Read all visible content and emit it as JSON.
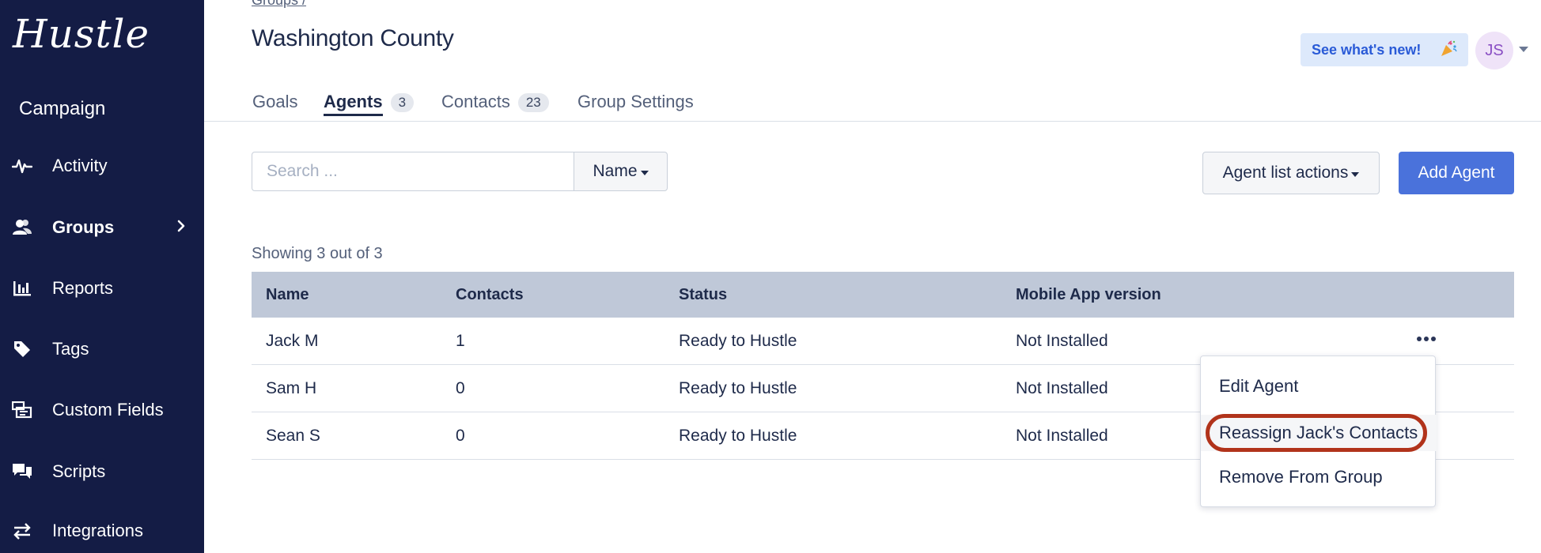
{
  "sidebar": {
    "logo": "Hustle",
    "section_title": "Campaign",
    "items": [
      {
        "label": "Activity",
        "icon": "pulse-icon"
      },
      {
        "label": "Groups",
        "icon": "users-icon",
        "active": true
      },
      {
        "label": "Reports",
        "icon": "bar-chart-icon"
      },
      {
        "label": "Tags",
        "icon": "tag-icon"
      },
      {
        "label": "Custom Fields",
        "icon": "form-fields-icon"
      },
      {
        "label": "Scripts",
        "icon": "chat-bubbles-icon"
      },
      {
        "label": "Integrations",
        "icon": "swap-arrows-icon"
      }
    ]
  },
  "header": {
    "breadcrumb": "Groups /",
    "title": "Washington County",
    "whats_new": "See what's new!",
    "whats_new_icon": "party-popper-icon",
    "avatar_initials": "JS"
  },
  "tabs": [
    {
      "label": "Goals"
    },
    {
      "label": "Agents",
      "count": "3",
      "active": true
    },
    {
      "label": "Contacts",
      "count": "23"
    },
    {
      "label": "Group Settings"
    }
  ],
  "toolbar": {
    "search_placeholder": "Search ...",
    "sort_label": "Name",
    "list_actions_label": "Agent list actions",
    "add_agent_label": "Add Agent"
  },
  "showing_text": "Showing 3 out of 3",
  "table": {
    "columns": [
      "Name",
      "Contacts",
      "Status",
      "Mobile App version"
    ],
    "rows": [
      {
        "name": "Jack M",
        "contacts": "1",
        "status": "Ready to Hustle",
        "app": "Not Installed"
      },
      {
        "name": "Sam H",
        "contacts": "0",
        "status": "Ready to Hustle",
        "app": "Not Installed"
      },
      {
        "name": "Sean S",
        "contacts": "0",
        "status": "Ready to Hustle",
        "app": "Not Installed"
      }
    ]
  },
  "row_menu": {
    "items": [
      "Edit Agent",
      "Reassign Jack's Contacts",
      "Remove From Group"
    ]
  },
  "colors": {
    "sidebar_bg": "#141c45",
    "primary": "#4a72db",
    "table_header": "#bfc8d8",
    "highlight_ring": "#b1331b"
  }
}
